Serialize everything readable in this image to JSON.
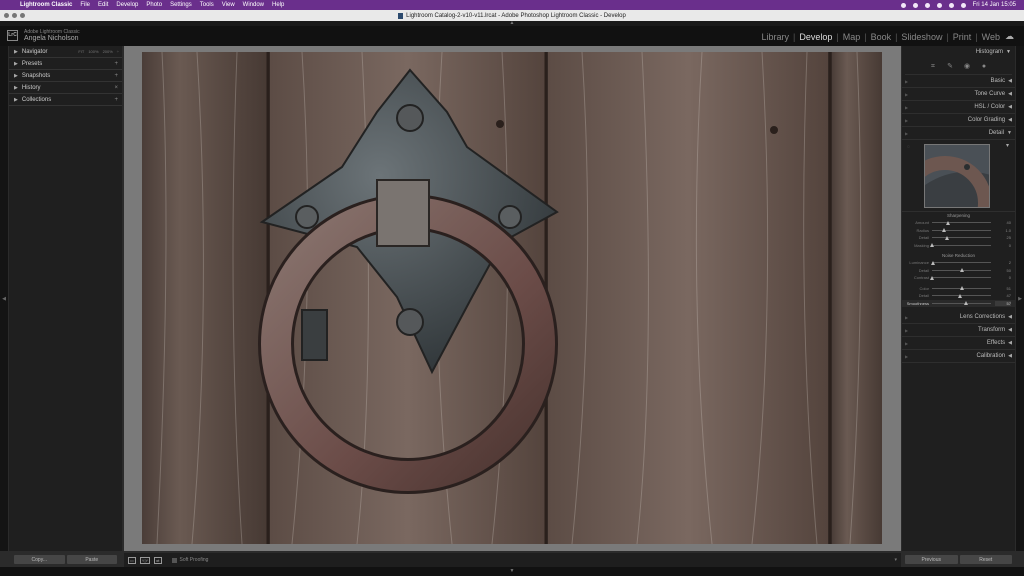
{
  "menubar": {
    "app": "Lightroom Classic",
    "items": [
      "File",
      "Edit",
      "Develop",
      "Photo",
      "Settings",
      "Tools",
      "View",
      "Window",
      "Help"
    ],
    "datetime": "Fri 14 Jan  15:05"
  },
  "window": {
    "title": "Lightroom Catalog-2-v10-v11.lrcat - Adobe Photoshop Lightroom Classic - Develop"
  },
  "identity": {
    "logo": "LrC",
    "product": "Adobe Lightroom Classic",
    "user": "Angela Nicholson"
  },
  "modules": {
    "items": [
      "Library",
      "Develop",
      "Map",
      "Book",
      "Slideshow",
      "Print",
      "Web"
    ],
    "active": "Develop"
  },
  "left_panel": {
    "navigator": {
      "label": "Navigator",
      "options": [
        "FIT",
        "100%",
        "200%"
      ]
    },
    "panels": [
      "Presets",
      "Snapshots",
      "History",
      "Collections"
    ],
    "copy_label": "Copy...",
    "paste_label": "Paste"
  },
  "right_panel": {
    "histogram": "Histogram",
    "sections": [
      "Basic",
      "Tone Curve",
      "HSL / Color",
      "Color Grading",
      "Detail"
    ],
    "detail": {
      "sharpening_title": "Sharpening",
      "sharpening": [
        {
          "label": "Amount",
          "value": "40",
          "pos": 0.27
        },
        {
          "label": "Radius",
          "value": "1.0",
          "pos": 0.2
        },
        {
          "label": "Detail",
          "value": "25",
          "pos": 0.25
        },
        {
          "label": "Masking",
          "value": "0",
          "pos": 0.0
        }
      ],
      "noise_title": "Noise Reduction",
      "noise": [
        {
          "label": "Luminance",
          "value": "2",
          "pos": 0.02
        },
        {
          "label": "Detail",
          "value": "50",
          "pos": 0.5
        },
        {
          "label": "Contrast",
          "value": "0",
          "pos": 0.0
        },
        {
          "label": "Color",
          "value": "51",
          "pos": 0.51
        },
        {
          "label": "Detail",
          "value": "47",
          "pos": 0.47
        },
        {
          "label": "Smoothness",
          "value": "57",
          "pos": 0.57
        }
      ]
    },
    "lower_sections": [
      "Lens Corrections",
      "Transform",
      "Effects",
      "Calibration"
    ],
    "previous_label": "Previous",
    "reset_label": "Reset"
  },
  "toolbar": {
    "soft_proofing": "Soft Proofing"
  },
  "colors": {
    "menubar": "#6a2f8c",
    "panel": "#1f1f1f",
    "background": "#7a7a7a"
  }
}
